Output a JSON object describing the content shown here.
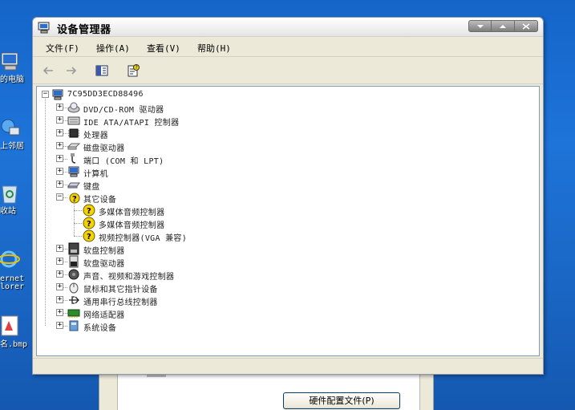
{
  "desktop": {
    "icons": [
      {
        "label": "的电脑",
        "icon": "computer-icon"
      },
      {
        "label": "上邻居",
        "icon": "network-icon"
      },
      {
        "label": "收站",
        "icon": "recycle-bin-icon"
      },
      {
        "label": "ernet",
        "label2": "lorer",
        "icon": "ie-icon"
      },
      {
        "label": "名.bmp",
        "icon": "bmp-file-icon"
      }
    ]
  },
  "background_dialog": {
    "button_label": "硬件配置文件(P)"
  },
  "window": {
    "title": "设备管理器",
    "menu": [
      "文件(F)",
      "操作(A)",
      "查看(V)",
      "帮助(H)"
    ],
    "tree": {
      "root": "7C95DD3ECD88496",
      "items": [
        {
          "label": "DVD/CD-ROM 驱动器",
          "icon": "dvd-drive-icon",
          "expanded": false
        },
        {
          "label": "IDE ATA/ATAPI 控制器",
          "icon": "ide-controller-icon",
          "expanded": false
        },
        {
          "label": "处理器",
          "icon": "processor-icon",
          "expanded": false
        },
        {
          "label": "磁盘驱动器",
          "icon": "disk-drive-icon",
          "expanded": false
        },
        {
          "label": "端口 (COM 和 LPT)",
          "icon": "port-icon",
          "expanded": false
        },
        {
          "label": "计算机",
          "icon": "computer-icon",
          "expanded": false
        },
        {
          "label": "键盘",
          "icon": "keyboard-icon",
          "expanded": false
        },
        {
          "label": "其它设备",
          "icon": "unknown-device-icon",
          "expanded": true,
          "children": [
            {
              "label": "多媒体音频控制器",
              "icon": "warning-icon"
            },
            {
              "label": "多媒体音频控制器",
              "icon": "warning-icon"
            },
            {
              "label": "视频控制器(VGA 兼容)",
              "icon": "warning-icon"
            }
          ]
        },
        {
          "label": "软盘控制器",
          "icon": "floppy-controller-icon",
          "expanded": false
        },
        {
          "label": "软盘驱动器",
          "icon": "floppy-drive-icon",
          "expanded": false
        },
        {
          "label": "声音、视频和游戏控制器",
          "icon": "sound-icon",
          "expanded": false
        },
        {
          "label": "鼠标和其它指针设备",
          "icon": "mouse-icon",
          "expanded": false
        },
        {
          "label": "通用串行总线控制器",
          "icon": "usb-icon",
          "expanded": false
        },
        {
          "label": "网络适配器",
          "icon": "network-adapter-icon",
          "expanded": false
        },
        {
          "label": "系统设备",
          "icon": "system-device-icon",
          "expanded": false
        }
      ]
    }
  },
  "colors": {
    "desktop": "#1e74d9",
    "window_face": "#ece9d8",
    "tree_bg": "#ffffff",
    "warning": "#f3d400"
  }
}
